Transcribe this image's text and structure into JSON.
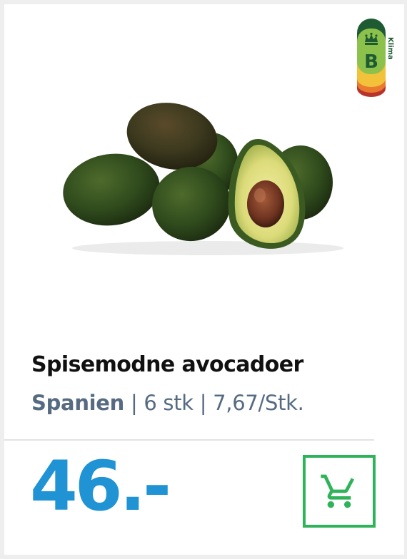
{
  "product": {
    "title": "Spisemodne avocadoer",
    "origin": "Spanien",
    "separator": "|",
    "quantity": "6 stk",
    "unit_price": "7,67/Stk.",
    "price": "46.-",
    "image": "avocado-product-image"
  },
  "climate_label": {
    "heading": "Klima",
    "grade": "B",
    "icon": "crown-icon"
  },
  "cart": {
    "icon": "shopping-cart-icon"
  },
  "colors": {
    "price": "#1f93d3",
    "cart_accent": "#2fb35a",
    "meta_text": "#566b82",
    "climate_dark_green": "#1e5b32",
    "climate_light_green": "#8cc24b",
    "climate_yellow": "#f2c23a",
    "climate_orange": "#e97a2e",
    "climate_red": "#b8342a"
  }
}
